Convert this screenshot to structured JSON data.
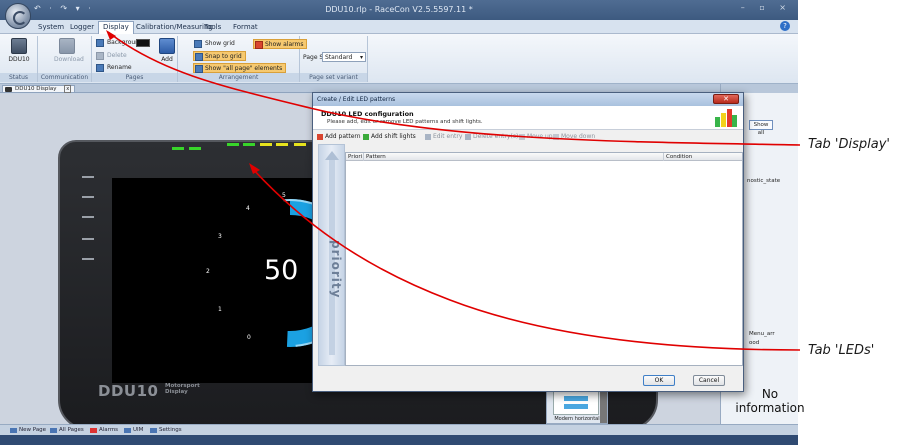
{
  "window": {
    "title": "DDU10.rlp - RaceCon V2.5.5597.11 *",
    "controls": "– ▫ ×"
  },
  "quick_access": "↶ · ↷ ▾ ·",
  "ribbon_tabs": [
    "System",
    "Logger",
    "Display",
    "Calibration/Measuring",
    "Tools",
    "Format"
  ],
  "ribbon": {
    "groups": [
      "Status",
      "Communication",
      "Pages",
      "Arrangement",
      "Page set variant"
    ],
    "ddu10": "DDU10",
    "download": "Download",
    "background": "Background",
    "rename": "Rename",
    "delete": "Delete",
    "add": "Add",
    "show_grid": "Show grid",
    "snap_to_grid": "Snap to grid",
    "show_all_page_elements": "Show \"all page\" elements",
    "show_alarms": "Show alarms",
    "page_set_label": "Page Set",
    "page_set_value": "Standard"
  },
  "document_tab": {
    "label": "DDU10 Display",
    "close": "x"
  },
  "device": {
    "speed": "50",
    "ticks": [
      "0",
      "1",
      "2",
      "3",
      "4",
      "5"
    ],
    "brand": "DDU10",
    "brand_sub_1": "Motorsport",
    "brand_sub_2": "Display"
  },
  "dialog": {
    "title": "Create / Edit LED patterns",
    "close": "✕",
    "header_title": "DDU10 LED configuration",
    "header_desc": "Please add, edit or remove LED patterns and shift lights.",
    "toolbar": {
      "add_pattern": "Add pattern",
      "add_shift_lights": "Add shift lights",
      "edit_entry": "Edit entry",
      "delete_entries": "Delete entry(s)",
      "move_up": "Move up",
      "move_down": "Move down"
    },
    "priority_label": "priority",
    "columns": [
      "Priori",
      "Pattern",
      "Condition"
    ],
    "ok": "OK",
    "cancel": "Cancel"
  },
  "right_panel": {
    "show_all": "Show all",
    "item_1": "nostic_state",
    "item_2": "Menu_arr",
    "item_3": "ood"
  },
  "thumbnail": {
    "label": "Modern horizontal"
  },
  "bottom_tabs": [
    "New Page",
    "All Pages",
    "Alarms",
    "UIM",
    "Settings"
  ],
  "no_information": "No information",
  "annotations": {
    "tab_display": "Tab 'Display'",
    "tab_leds": "Tab 'LEDs'",
    "color": "#e00000"
  },
  "colors": {
    "led_green": "#38d52a",
    "led_yellow": "#e7e31d",
    "gauge_blue": "#1ba1e2"
  }
}
